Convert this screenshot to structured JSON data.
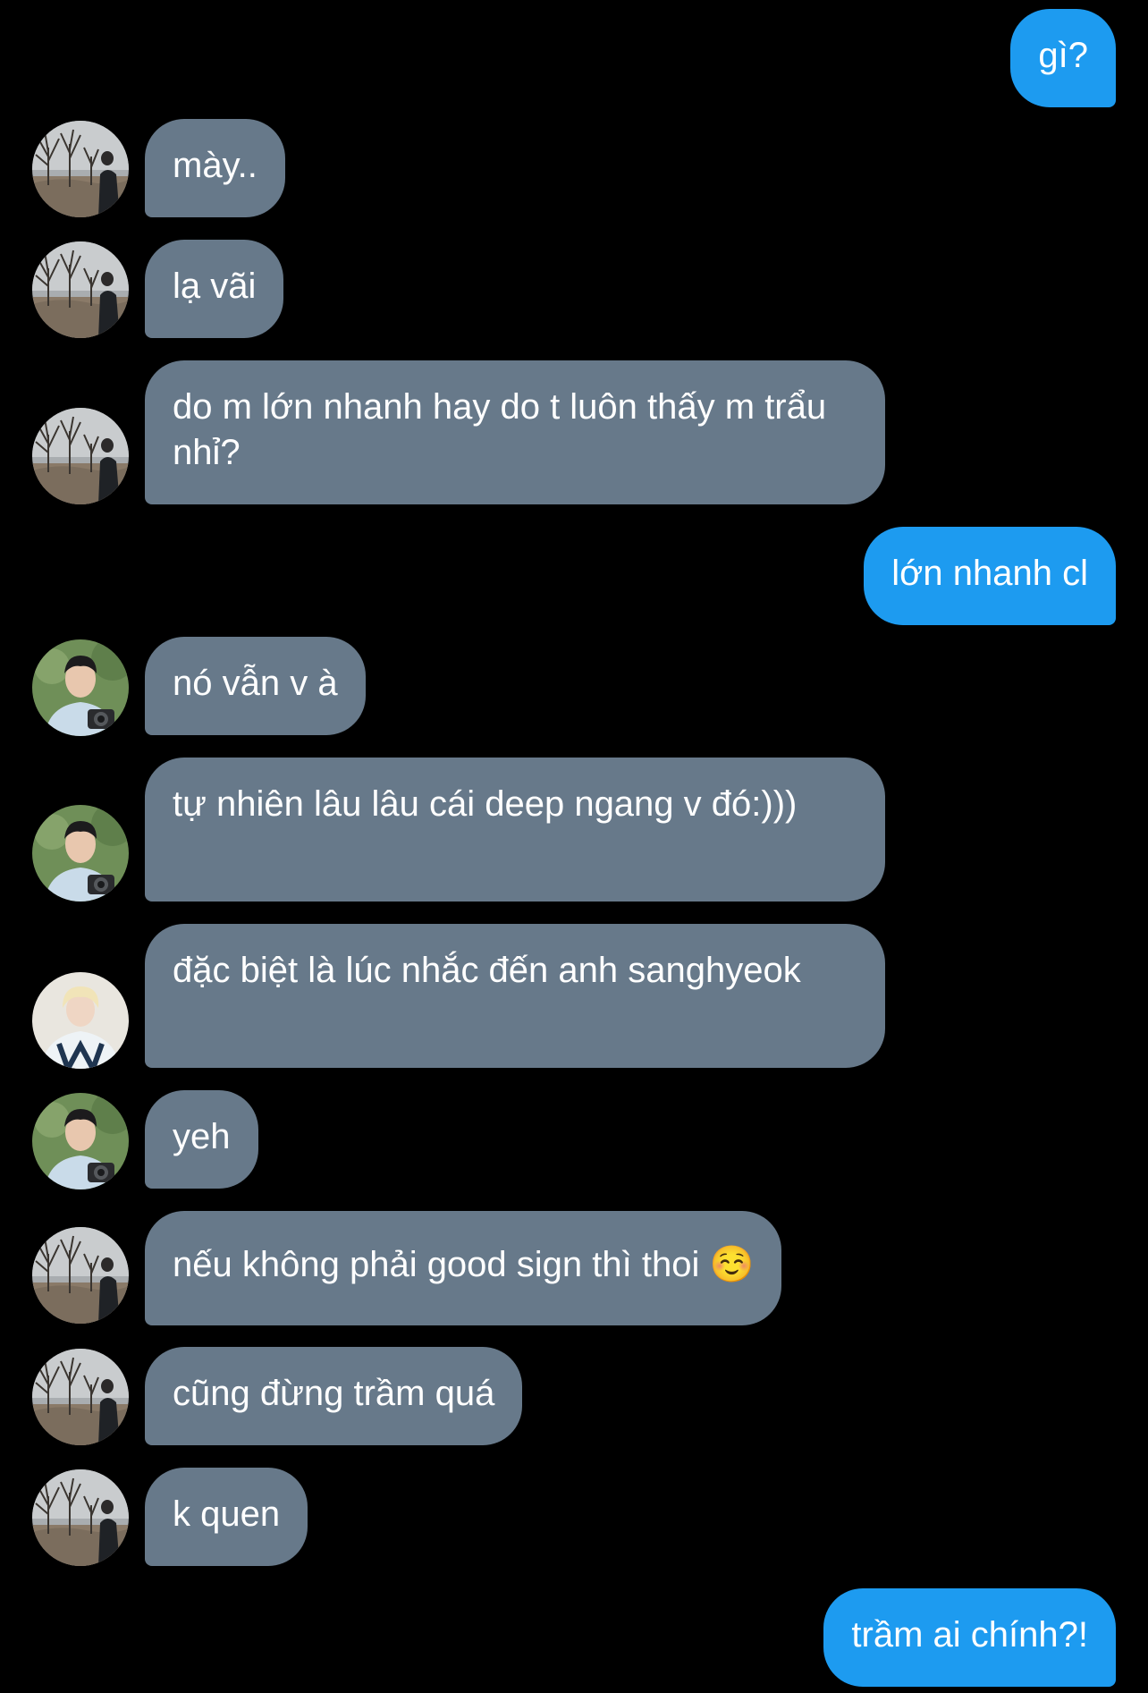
{
  "conversation": {
    "messages": [
      {
        "sender": "me",
        "text": "gì?"
      },
      {
        "sender": "winter-trees",
        "text": "mày.."
      },
      {
        "sender": "winter-trees",
        "text": "lạ vãi"
      },
      {
        "sender": "winter-trees",
        "text": "do m lớn nhanh hay do t luôn thấy m trẩu nhỉ?"
      },
      {
        "sender": "me",
        "text": "lớn nhanh cl"
      },
      {
        "sender": "camera",
        "text": "nó vẫn v à"
      },
      {
        "sender": "camera",
        "text": "tự nhiên lâu lâu cái deep ngang v đó:)))"
      },
      {
        "sender": "blonde",
        "text": "đặc biệt là lúc nhắc đến anh sanghyeok"
      },
      {
        "sender": "camera",
        "text": "yeh"
      },
      {
        "sender": "winter-trees",
        "text": "nếu không phải good sign thì thoi",
        "emoji": "☺️"
      },
      {
        "sender": "winter-trees",
        "text": "cũng đừng trầm quá"
      },
      {
        "sender": "winter-trees",
        "text": "k quen"
      },
      {
        "sender": "me",
        "text": "trầm ai chính?!"
      }
    ]
  },
  "colors": {
    "background": "#000000",
    "incoming_bubble": "#67798a",
    "outgoing_bubble": "#1d9bf0",
    "text": "#ffffff"
  },
  "avatars": {
    "winter-trees": "avatar-icon",
    "camera": "avatar-icon",
    "blonde": "avatar-icon"
  }
}
